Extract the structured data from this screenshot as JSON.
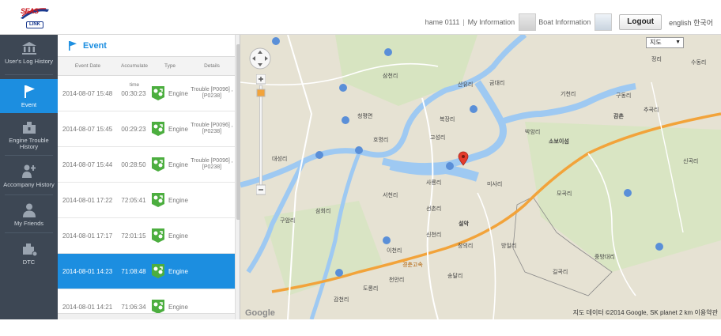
{
  "brand": {
    "logo_main": "SEAS",
    "logo_sub": "LINK"
  },
  "header": {
    "user": "hame 0111",
    "my_info": "My Information",
    "boat_info": "Boat Information",
    "logout_label": "Logout",
    "lang": "english 한국어"
  },
  "nav": {
    "items": [
      {
        "label": "User's Log History",
        "icon": "bank-icon"
      },
      {
        "label": "Event",
        "icon": "flag-icon",
        "active": true
      },
      {
        "label": "Engine Trouble History",
        "icon": "engine-trouble-icon"
      },
      {
        "label": "Accompany History",
        "icon": "accompany-icon"
      },
      {
        "label": "My Friends",
        "icon": "person-icon"
      },
      {
        "label": "DTC",
        "icon": "dtc-icon"
      }
    ]
  },
  "panel": {
    "title": "Event",
    "columns": [
      "Event Date",
      "Accumulate time",
      "Type",
      "Details"
    ],
    "rows": [
      {
        "date": "2014-08-07 15:48",
        "acc": "00:30:23",
        "type": "Engine",
        "details": "Trouble [P0096] , [P0238]"
      },
      {
        "date": "2014-08-07 15:45",
        "acc": "00:29:23",
        "type": "Engine",
        "details": "Trouble [P0096] , [P0238]"
      },
      {
        "date": "2014-08-07 15:44",
        "acc": "00:28:50",
        "type": "Engine",
        "details": "Trouble [P0096] , [P0238]"
      },
      {
        "date": "2014-08-01 17:22",
        "acc": "72:05:41",
        "type": "Engine",
        "details": ""
      },
      {
        "date": "2014-08-01 17:17",
        "acc": "72:01:15",
        "type": "Engine",
        "details": ""
      },
      {
        "date": "2014-08-01 14:23",
        "acc": "71:08:48",
        "type": "Engine",
        "details": "",
        "selected": true
      },
      {
        "date": "2014-08-01 14:21",
        "acc": "71:06:34",
        "type": "Engine",
        "details": ""
      }
    ]
  },
  "map": {
    "type_select": "지도",
    "footer": "지도 데이터 ©2014 Google, SK planet   2 km   이용약관",
    "google": "Google",
    "labels": [
      "삼천리",
      "금대리",
      "산유리",
      "기천리",
      "구동리",
      "추곡리",
      "수동리",
      "정리",
      "박암리",
      "소보이섬",
      "감촌",
      "청평면",
      "호명리",
      "복장리",
      "신곡리",
      "대성리",
      "고성리",
      "사룡리",
      "미사리",
      "서천리",
      "삼회리",
      "선촌리",
      "구암리",
      "창의리",
      "신천리",
      "설악",
      "방일리",
      "천안리",
      "송달리",
      "이천리",
      "경춘고속",
      "길곡리",
      "모곡리",
      "중방대리",
      "도롱리",
      "감천리"
    ],
    "colors": {
      "land": "#e6e2d3",
      "water": "#9ec9f2",
      "highway": "#f2a33a",
      "road": "#ffffff",
      "green": "#cfe2b8",
      "marker": "#e53b2c"
    }
  }
}
